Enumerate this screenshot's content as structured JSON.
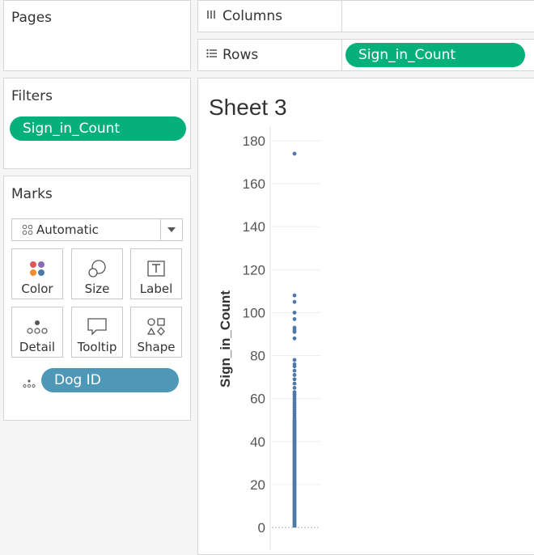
{
  "pages": {
    "title": "Pages"
  },
  "filters": {
    "title": "Filters",
    "pill": "Sign_in_Count"
  },
  "marks": {
    "title": "Marks",
    "mark_type": "Automatic",
    "buttons": [
      {
        "label": "Color",
        "icon": "color-icon"
      },
      {
        "label": "Size",
        "icon": "size-icon"
      },
      {
        "label": "Label",
        "icon": "label-icon"
      },
      {
        "label": "Detail",
        "icon": "detail-icon"
      },
      {
        "label": "Tooltip",
        "icon": "tooltip-icon"
      },
      {
        "label": "Shape",
        "icon": "shape-icon"
      }
    ],
    "detail_pill": "Dog ID"
  },
  "columns_shelf": {
    "label": "Columns",
    "icon": "columns-icon"
  },
  "rows_shelf": {
    "label": "Rows",
    "icon": "rows-icon",
    "pill": "Sign_in_Count"
  },
  "sheet": {
    "title": "Sheet 3"
  },
  "colors": {
    "green_pill": "#06b07a",
    "blue_pill": "#4f97b6",
    "mark": "#4e79a7"
  },
  "chart_data": {
    "type": "scatter",
    "title": "",
    "ylabel": "Sign_in_Count",
    "xlabel": "",
    "ylim": [
      0,
      180
    ],
    "yticks": [
      0,
      20,
      40,
      60,
      80,
      100,
      120,
      140,
      160,
      180
    ],
    "grid": true,
    "dense_range": [
      0,
      50
    ],
    "y": [
      174,
      108,
      105,
      100,
      97,
      93,
      92,
      91,
      88,
      78,
      76,
      75,
      73,
      71,
      69,
      67,
      65,
      63,
      62,
      61,
      60,
      59,
      58,
      57,
      56,
      55,
      54,
      53,
      52,
      51,
      50
    ]
  }
}
